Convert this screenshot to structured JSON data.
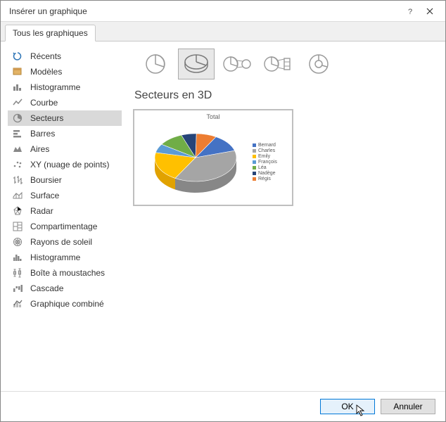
{
  "dialog_title": "Insérer un graphique",
  "tab_label": "Tous les graphiques",
  "sidebar": {
    "items": [
      {
        "label": "Récents",
        "icon": "recent-icon"
      },
      {
        "label": "Modèles",
        "icon": "template-icon"
      },
      {
        "label": "Histogramme",
        "icon": "column-chart-icon"
      },
      {
        "label": "Courbe",
        "icon": "line-chart-icon"
      },
      {
        "label": "Secteurs",
        "icon": "pie-chart-icon",
        "selected": true
      },
      {
        "label": "Barres",
        "icon": "bar-chart-icon"
      },
      {
        "label": "Aires",
        "icon": "area-chart-icon"
      },
      {
        "label": "XY (nuage de points)",
        "icon": "scatter-chart-icon"
      },
      {
        "label": "Boursier",
        "icon": "stock-chart-icon"
      },
      {
        "label": "Surface",
        "icon": "surface-chart-icon"
      },
      {
        "label": "Radar",
        "icon": "radar-chart-icon"
      },
      {
        "label": "Compartimentage",
        "icon": "treemap-icon"
      },
      {
        "label": "Rayons de soleil",
        "icon": "sunburst-icon"
      },
      {
        "label": "Histogramme",
        "icon": "histogram-icon"
      },
      {
        "label": "Boîte à moustaches",
        "icon": "boxplot-icon"
      },
      {
        "label": "Cascade",
        "icon": "waterfall-icon"
      },
      {
        "label": "Graphique combiné",
        "icon": "combo-chart-icon"
      }
    ]
  },
  "subtypes": [
    "pie",
    "pie-3d",
    "pie-of-pie",
    "bar-of-pie",
    "doughnut"
  ],
  "selected_subtype": 1,
  "preview_heading": "Secteurs en 3D",
  "buttons": {
    "ok": "OK",
    "cancel": "Annuler"
  },
  "chart_data": {
    "type": "pie",
    "title": "Total",
    "series": [
      {
        "name": "Bernard",
        "value": 12,
        "color": "#4472C4"
      },
      {
        "name": "Charles",
        "value": 38,
        "color": "#A5A5A5"
      },
      {
        "name": "Emily",
        "value": 20,
        "color": "#FFC000"
      },
      {
        "name": "François",
        "value": 6,
        "color": "#5B9BD5"
      },
      {
        "name": "Léa",
        "value": 10,
        "color": "#70AD47"
      },
      {
        "name": "Nadège",
        "value": 6,
        "color": "#264478"
      },
      {
        "name": "Régis",
        "value": 8,
        "color": "#ED7D31"
      }
    ]
  }
}
